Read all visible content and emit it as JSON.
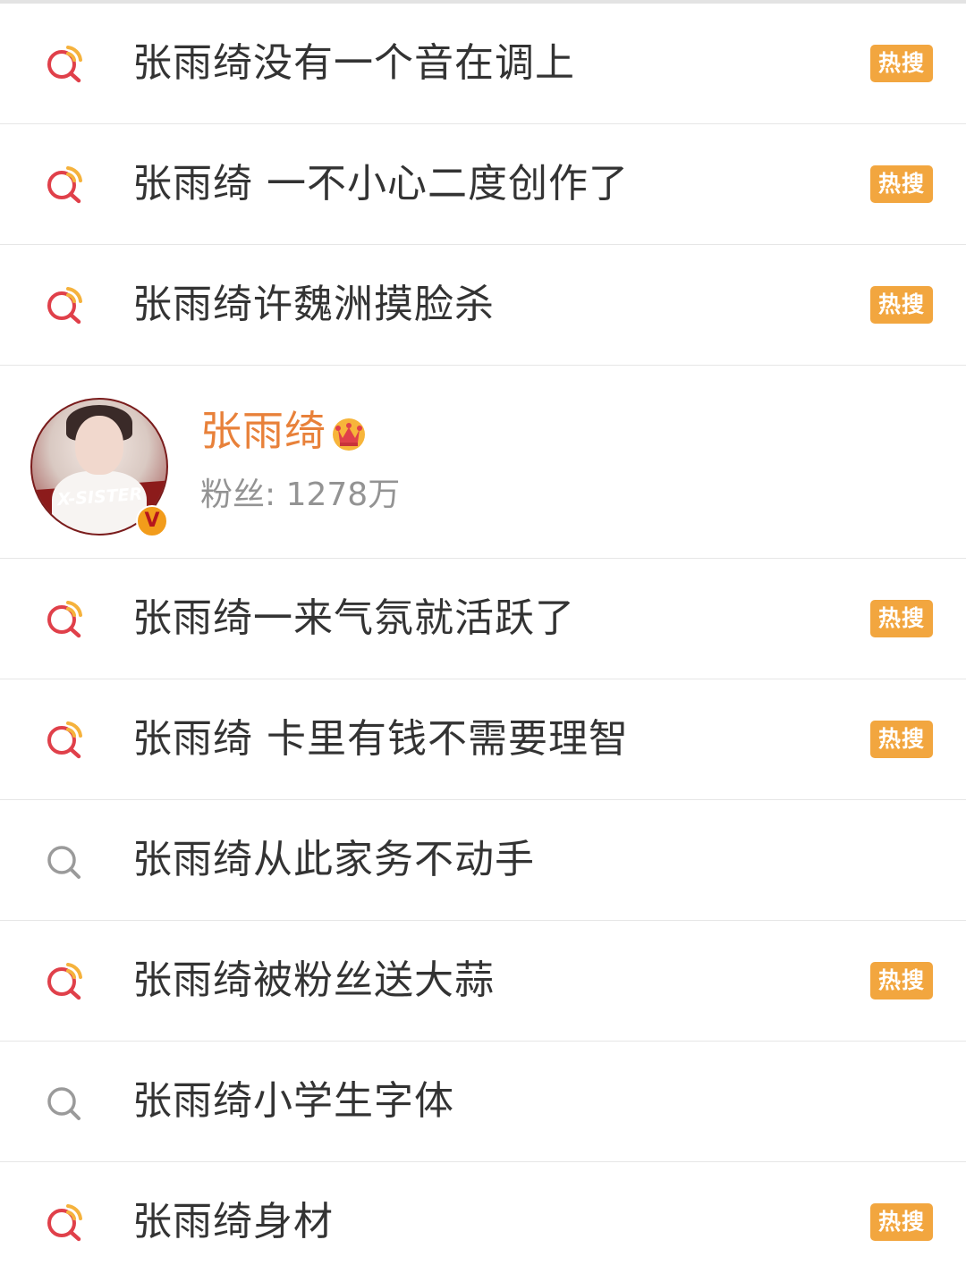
{
  "badge_label": "热搜",
  "colors": {
    "hot_icon": "#e0404a",
    "hot_icon_accent": "#f5b23c",
    "plain_icon": "#9a9a9a",
    "badge_bg": "#f2a63f",
    "user_name": "#e8813a",
    "text": "#333333"
  },
  "items_top": [
    {
      "text": "张雨绮没有一个音在调上",
      "icon": "hot-search-icon",
      "hot": true
    },
    {
      "text": "张雨绮 一不小心二度创作了",
      "icon": "hot-search-icon",
      "hot": true
    },
    {
      "text": "张雨绮许魏洲摸脸杀",
      "icon": "hot-search-icon",
      "hot": true
    }
  ],
  "user_card": {
    "name": "张雨绮",
    "fans_text": "粉丝: 1278万",
    "avatar_label": "X-SISTER",
    "verified_mark": "V",
    "icons": [
      "avatar",
      "crown-icon",
      "verified-icon"
    ]
  },
  "items_bottom": [
    {
      "text": "张雨绮一来气氛就活跃了",
      "icon": "hot-search-icon",
      "hot": true
    },
    {
      "text": "张雨绮 卡里有钱不需要理智",
      "icon": "hot-search-icon",
      "hot": true
    },
    {
      "text": "张雨绮从此家务不动手",
      "icon": "search-icon",
      "hot": false
    },
    {
      "text": "张雨绮被粉丝送大蒜",
      "icon": "hot-search-icon",
      "hot": true
    },
    {
      "text": "张雨绮小学生字体",
      "icon": "search-icon",
      "hot": false
    },
    {
      "text": "张雨绮身材",
      "icon": "hot-search-icon",
      "hot": true
    }
  ]
}
